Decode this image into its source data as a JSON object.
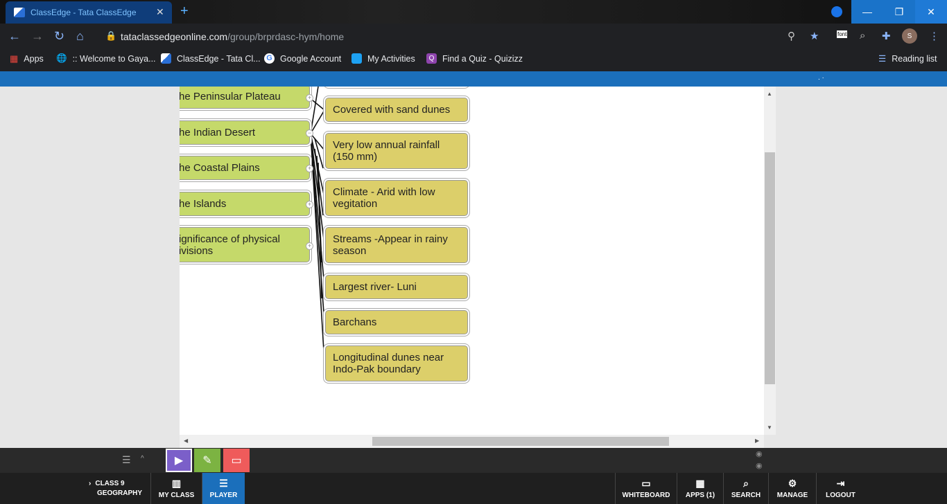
{
  "browser": {
    "tab_title": "ClassEdge - Tata ClassEdge",
    "url_host": "tataclassedgeonline.com",
    "url_path": "/group/brprdasc-hym/home",
    "avatar_letter": "S",
    "font_ext_label": "font",
    "bookmarks": [
      {
        "label": "Apps",
        "icon": "apps-grid-icon",
        "color": "#e8453c"
      },
      {
        "label": ":: Welcome to Gaya...",
        "icon": "globe-icon",
        "color": "#4a8af4"
      },
      {
        "label": "ClassEdge - Tata Cl...",
        "icon": "classedge-icon",
        "color": "#2a6fd6"
      },
      {
        "label": "Google Account",
        "icon": "google-icon",
        "color": "#ffffff"
      },
      {
        "label": "My Activities",
        "icon": "activities-icon",
        "color": "#1da1f2"
      },
      {
        "label": "Find a Quiz - Quizizz",
        "icon": "quizizz-icon",
        "color": "#8e44ad"
      }
    ],
    "reading_list": "Reading list"
  },
  "mindmap": {
    "left_nodes": [
      {
        "label": "he Peninsular Plateau",
        "knob": "+"
      },
      {
        "label": "he Indian Desert",
        "knob": "−"
      },
      {
        "label": "he Coastal Plains",
        "knob": "+"
      },
      {
        "label": "he Islands",
        "knob": "+"
      },
      {
        "label": "ignificance of physical ivisions",
        "knob": "+"
      }
    ],
    "right_nodes": [
      "Covered with sand dunes",
      "Very low annual rainfall (150 mm)",
      "Climate - Arid with low vegitation",
      "Streams -Appear in rainy season",
      "Largest river- Luni",
      "Barchans",
      "Longitudinal dunes near Indo-Pak boundary"
    ],
    "colors": {
      "green": "#c5d96a",
      "yellow": "#dccf6a"
    }
  },
  "bottom_nav": {
    "class_line1": "CLASS 9",
    "class_line2": "GEOGRAPHY",
    "my_class": "MY CLASS",
    "player": "PLAYER",
    "whiteboard": "WHITEBOARD",
    "apps": "APPS (1)",
    "search": "SEARCH",
    "manage": "MANAGE",
    "logout": "LOGOUT"
  }
}
